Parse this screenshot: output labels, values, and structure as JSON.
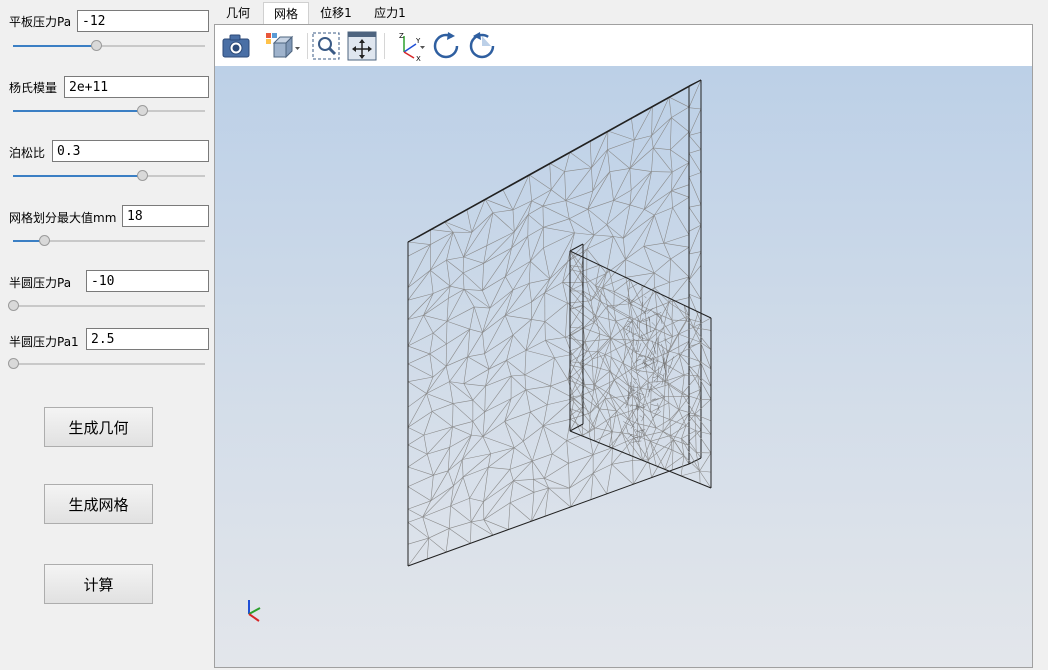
{
  "params": {
    "plate_pressure": {
      "label": "平板压力Pa",
      "value": "-12",
      "slider_fraction": 0.43
    },
    "youngs_modulus": {
      "label": "杨氏模量",
      "value": "2e+11",
      "slider_fraction": 0.67
    },
    "poisson_ratio": {
      "label": "泊松比",
      "value": "0.3",
      "slider_fraction": 0.67
    },
    "mesh_max_size": {
      "label": "网格划分最大值mm",
      "value": "18",
      "slider_fraction": 0.16
    },
    "semicircle_pressure": {
      "label": "半圆压力Pa",
      "value": "-10",
      "slider_fraction": 0.0
    },
    "semicircle_pressure1": {
      "label": "半圆压力Pa1",
      "value": "2.5",
      "slider_fraction": 0.0
    }
  },
  "buttons": {
    "generate_geometry": "生成几何",
    "generate_mesh": "生成网格",
    "compute": "计算"
  },
  "tabs": [
    {
      "label": "几何",
      "active": false
    },
    {
      "label": "网格",
      "active": true
    },
    {
      "label": "位移1",
      "active": false
    },
    {
      "label": "应力1",
      "active": false
    }
  ],
  "toolbar_icons": [
    "camera-icon",
    "view-cube-icon",
    "zoom-box-icon",
    "fit-all-icon",
    "axis-triad-icon",
    "rotate-cw-icon",
    "rotate-ccw-icon"
  ],
  "colors": {
    "slider_fill": "#3b7fc4",
    "viewport_top": "#bcd0e7",
    "viewport_bottom": "#e3e6eb",
    "mesh_line": "#8a8a8a",
    "axis_x": "#d62728",
    "axis_y": "#2ca02c",
    "axis_z": "#1f4fd6"
  }
}
